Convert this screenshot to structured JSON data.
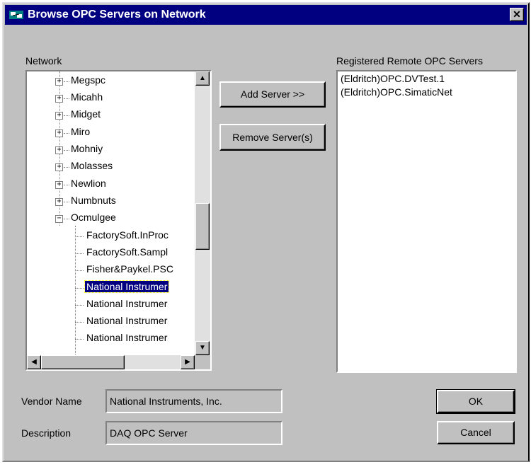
{
  "window": {
    "title": "Browse OPC Servers on Network",
    "close_glyph": "✕"
  },
  "labels": {
    "network": "Network",
    "registered": "Registered Remote OPC Servers",
    "vendor_name": "Vendor Name",
    "description": "Description"
  },
  "tree": {
    "nodes": [
      {
        "label": "Megspc",
        "expander": "+"
      },
      {
        "label": "Micahh",
        "expander": "+"
      },
      {
        "label": "Midget",
        "expander": "+"
      },
      {
        "label": "Miro",
        "expander": "+"
      },
      {
        "label": "Mohniy",
        "expander": "+"
      },
      {
        "label": "Molasses",
        "expander": "+"
      },
      {
        "label": "Newlion",
        "expander": "+"
      },
      {
        "label": "Numbnuts",
        "expander": "+"
      },
      {
        "label": "Ocmulgee",
        "expander": "−"
      }
    ],
    "children": [
      {
        "label": "FactorySoft.InProc"
      },
      {
        "label": "FactorySoft.Sampl"
      },
      {
        "label": "Fisher&Paykel.PSC"
      },
      {
        "label": "National Instrumer",
        "selected": true
      },
      {
        "label": "National Instrumer"
      },
      {
        "label": "National Instrumer"
      },
      {
        "label": "National Instrumer"
      }
    ]
  },
  "buttons": {
    "add_server": "Add Server >>",
    "remove_server": "Remove Server(s)",
    "ok": "OK",
    "cancel": "Cancel"
  },
  "registered_servers": [
    "(Eldritch)OPC.DVTest.1",
    "(Eldritch)OPC.SimaticNet"
  ],
  "fields": {
    "vendor_name": "National Instruments, Inc.",
    "description": "DAQ OPC Server"
  },
  "scrollbar_glyphs": {
    "up": "▲",
    "down": "▼",
    "left": "◀",
    "right": "▶"
  },
  "colors": {
    "titlebar": "#000080",
    "face": "#c0c0c0",
    "selection": "#000080"
  }
}
